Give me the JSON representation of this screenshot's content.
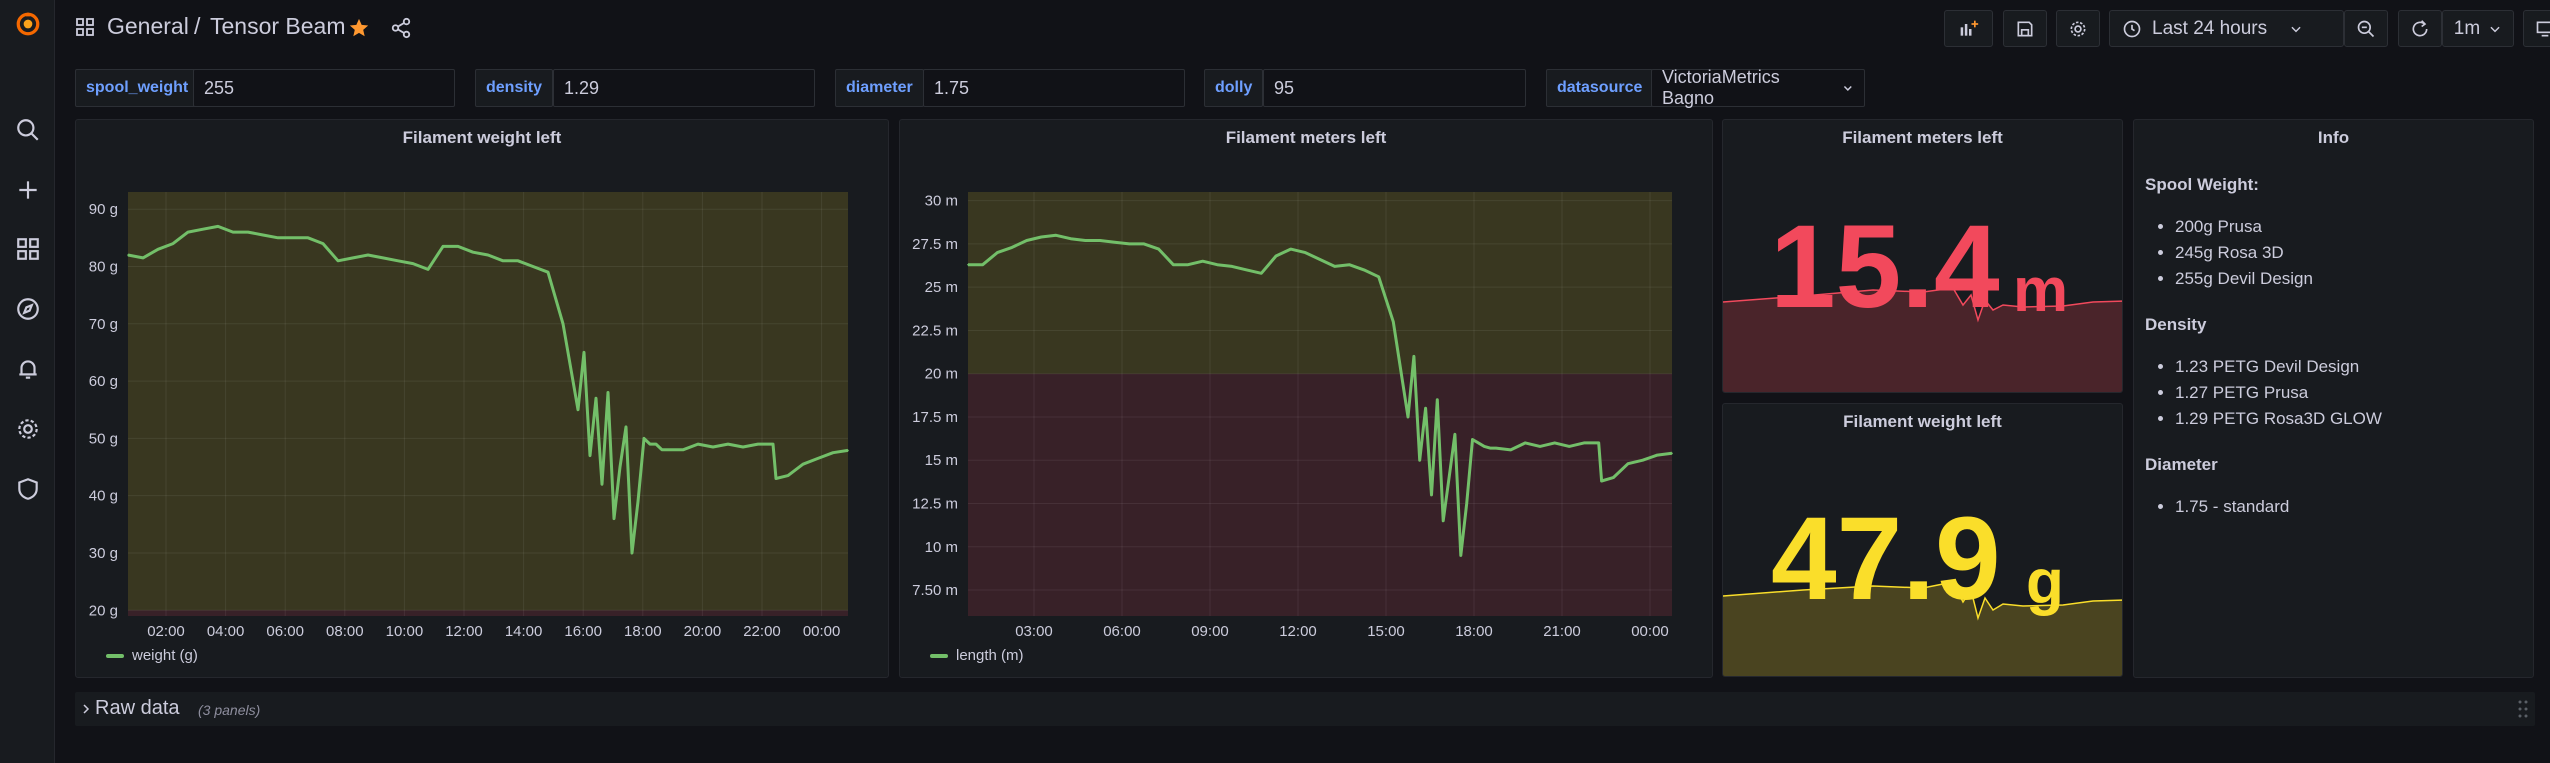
{
  "breadcrumb": {
    "folder": "General",
    "separator": "/",
    "dashboard": "Tensor Beam"
  },
  "toolbar": {
    "time_range": "Last 24 hours",
    "refresh_interval": "1m"
  },
  "variables": [
    {
      "name": "spool_weight",
      "value": "255"
    },
    {
      "name": "density",
      "value": "1.29"
    },
    {
      "name": "diameter",
      "value": "1.75"
    },
    {
      "name": "dolly",
      "value": "95"
    },
    {
      "name": "datasource",
      "value": "VictoriaMetrics Bagno"
    }
  ],
  "panels": {
    "weight_chart": {
      "title": "Filament weight left",
      "legend": "weight (g)"
    },
    "meters_chart": {
      "title": "Filament meters left",
      "legend": "length (m)"
    },
    "meters_stat": {
      "title": "Filament meters left",
      "value": "15.4",
      "unit": "m"
    },
    "weight_stat": {
      "title": "Filament weight left",
      "value": "47.9",
      "unit": "g"
    },
    "info": {
      "title": "Info",
      "sections": [
        {
          "heading": "Spool Weight:",
          "items": [
            "200g Prusa",
            "245g Rosa 3D",
            "255g Devil Design"
          ]
        },
        {
          "heading": "Density",
          "items": [
            "1.23 PETG Devil Design",
            "1.27 PETG Prusa",
            "1.29 PETG Rosa3D GLOW"
          ]
        },
        {
          "heading": "Diameter",
          "items": [
            "1.75 - standard"
          ]
        }
      ]
    }
  },
  "row": {
    "title": "Raw data",
    "subtitle": "(3 panels)"
  },
  "colors": {
    "green": "#73bf69",
    "red": "#f2495c",
    "yellow": "#fade2a",
    "blue_label": "#6e9fff",
    "orange_star": "#ff9830"
  },
  "chart_data": [
    {
      "type": "line",
      "title": "Filament weight left",
      "xlabel": "",
      "ylabel": "",
      "x_ticks": [
        "02:00",
        "04:00",
        "06:00",
        "08:00",
        "10:00",
        "12:00",
        "14:00",
        "16:00",
        "18:00",
        "20:00",
        "22:00",
        "00:00"
      ],
      "y_ticks": [
        "20 g",
        "30 g",
        "40 g",
        "50 g",
        "60 g",
        "70 g",
        "80 g",
        "90 g"
      ],
      "ylim": [
        19,
        93
      ],
      "x_hours": [
        0,
        0.5,
        1,
        1.5,
        2,
        2.5,
        3,
        3.5,
        4,
        4.5,
        5,
        5.5,
        6,
        6.5,
        7,
        7.5,
        8,
        8.5,
        9,
        9.5,
        10,
        10.5,
        11,
        11.5,
        12,
        12.5,
        13,
        13.5,
        14,
        14.5,
        15,
        15.2,
        15.4,
        15.6,
        15.8,
        16,
        16.2,
        16.4,
        16.6,
        16.8,
        17,
        17.2,
        17.4,
        17.6,
        17.8,
        18,
        18.5,
        19,
        19.5,
        20,
        20.5,
        21,
        21.5,
        21.6,
        22,
        22.5,
        23,
        23.5,
        24
      ],
      "series": [
        {
          "name": "weight (g)",
          "values": [
            82,
            81.5,
            83,
            84,
            86,
            86.5,
            87,
            86,
            86,
            85.5,
            85,
            85,
            85,
            84,
            81,
            81.5,
            82,
            81.5,
            81,
            80.5,
            79.5,
            83.5,
            83.5,
            82.5,
            82,
            81,
            81,
            80,
            79,
            70,
            55,
            65,
            47,
            57,
            42,
            58,
            36,
            45,
            52,
            30,
            39,
            50,
            49,
            49,
            48,
            48,
            48,
            49,
            48.5,
            49,
            48.5,
            49,
            49,
            43,
            43.5,
            45.5,
            46.5,
            47.5,
            47.9
          ]
        }
      ],
      "legend": "bottom-left",
      "thresholds": [
        {
          "from": 19,
          "to": 20,
          "color": "#f2495c"
        },
        {
          "from": 20,
          "to": 93,
          "color": "#fade2a"
        }
      ]
    },
    {
      "type": "line",
      "title": "Filament meters left",
      "xlabel": "",
      "ylabel": "",
      "x_ticks": [
        "03:00",
        "06:00",
        "09:00",
        "12:00",
        "15:00",
        "18:00",
        "21:00",
        "00:00"
      ],
      "y_ticks": [
        "7.50 m",
        "10 m",
        "12.5 m",
        "15 m",
        "17.5 m",
        "20 m",
        "22.5 m",
        "25 m",
        "27.5 m",
        "30 m"
      ],
      "ylim": [
        6,
        30.5
      ],
      "x_hours": [
        0,
        0.5,
        1,
        1.5,
        2,
        2.5,
        3,
        3.5,
        4,
        4.5,
        5,
        5.5,
        6,
        6.5,
        7,
        7.5,
        8,
        8.5,
        9,
        9.5,
        10,
        10.5,
        11,
        11.5,
        12,
        12.5,
        13,
        13.5,
        14,
        14.5,
        15,
        15.2,
        15.4,
        15.6,
        15.8,
        16,
        16.2,
        16.4,
        16.6,
        16.8,
        17,
        17.2,
        17.4,
        17.6,
        17.8,
        18,
        18.5,
        19,
        19.5,
        20,
        20.5,
        21,
        21.5,
        21.6,
        22,
        22.5,
        23,
        23.5,
        24
      ],
      "series": [
        {
          "name": "length (m)",
          "values": [
            26.3,
            26.3,
            27,
            27.3,
            27.7,
            27.9,
            28,
            27.8,
            27.7,
            27.7,
            27.6,
            27.5,
            27.5,
            27.2,
            26.3,
            26.3,
            26.5,
            26.3,
            26.2,
            26,
            25.8,
            26.8,
            27.2,
            27,
            26.6,
            26.2,
            26.3,
            26,
            25.6,
            23,
            17.5,
            21,
            15,
            18,
            13,
            18.5,
            11.5,
            14,
            16.5,
            9.5,
            12.5,
            16.2,
            16,
            15.8,
            15.7,
            15.7,
            15.6,
            16,
            15.8,
            16,
            15.8,
            16,
            16,
            13.8,
            14,
            14.8,
            15,
            15.3,
            15.4
          ]
        }
      ],
      "legend": "bottom-left",
      "thresholds": [
        {
          "from": 6,
          "to": 20,
          "color": "#f2495c"
        },
        {
          "from": 20,
          "to": 30.5,
          "color": "#fade2a"
        }
      ]
    }
  ]
}
